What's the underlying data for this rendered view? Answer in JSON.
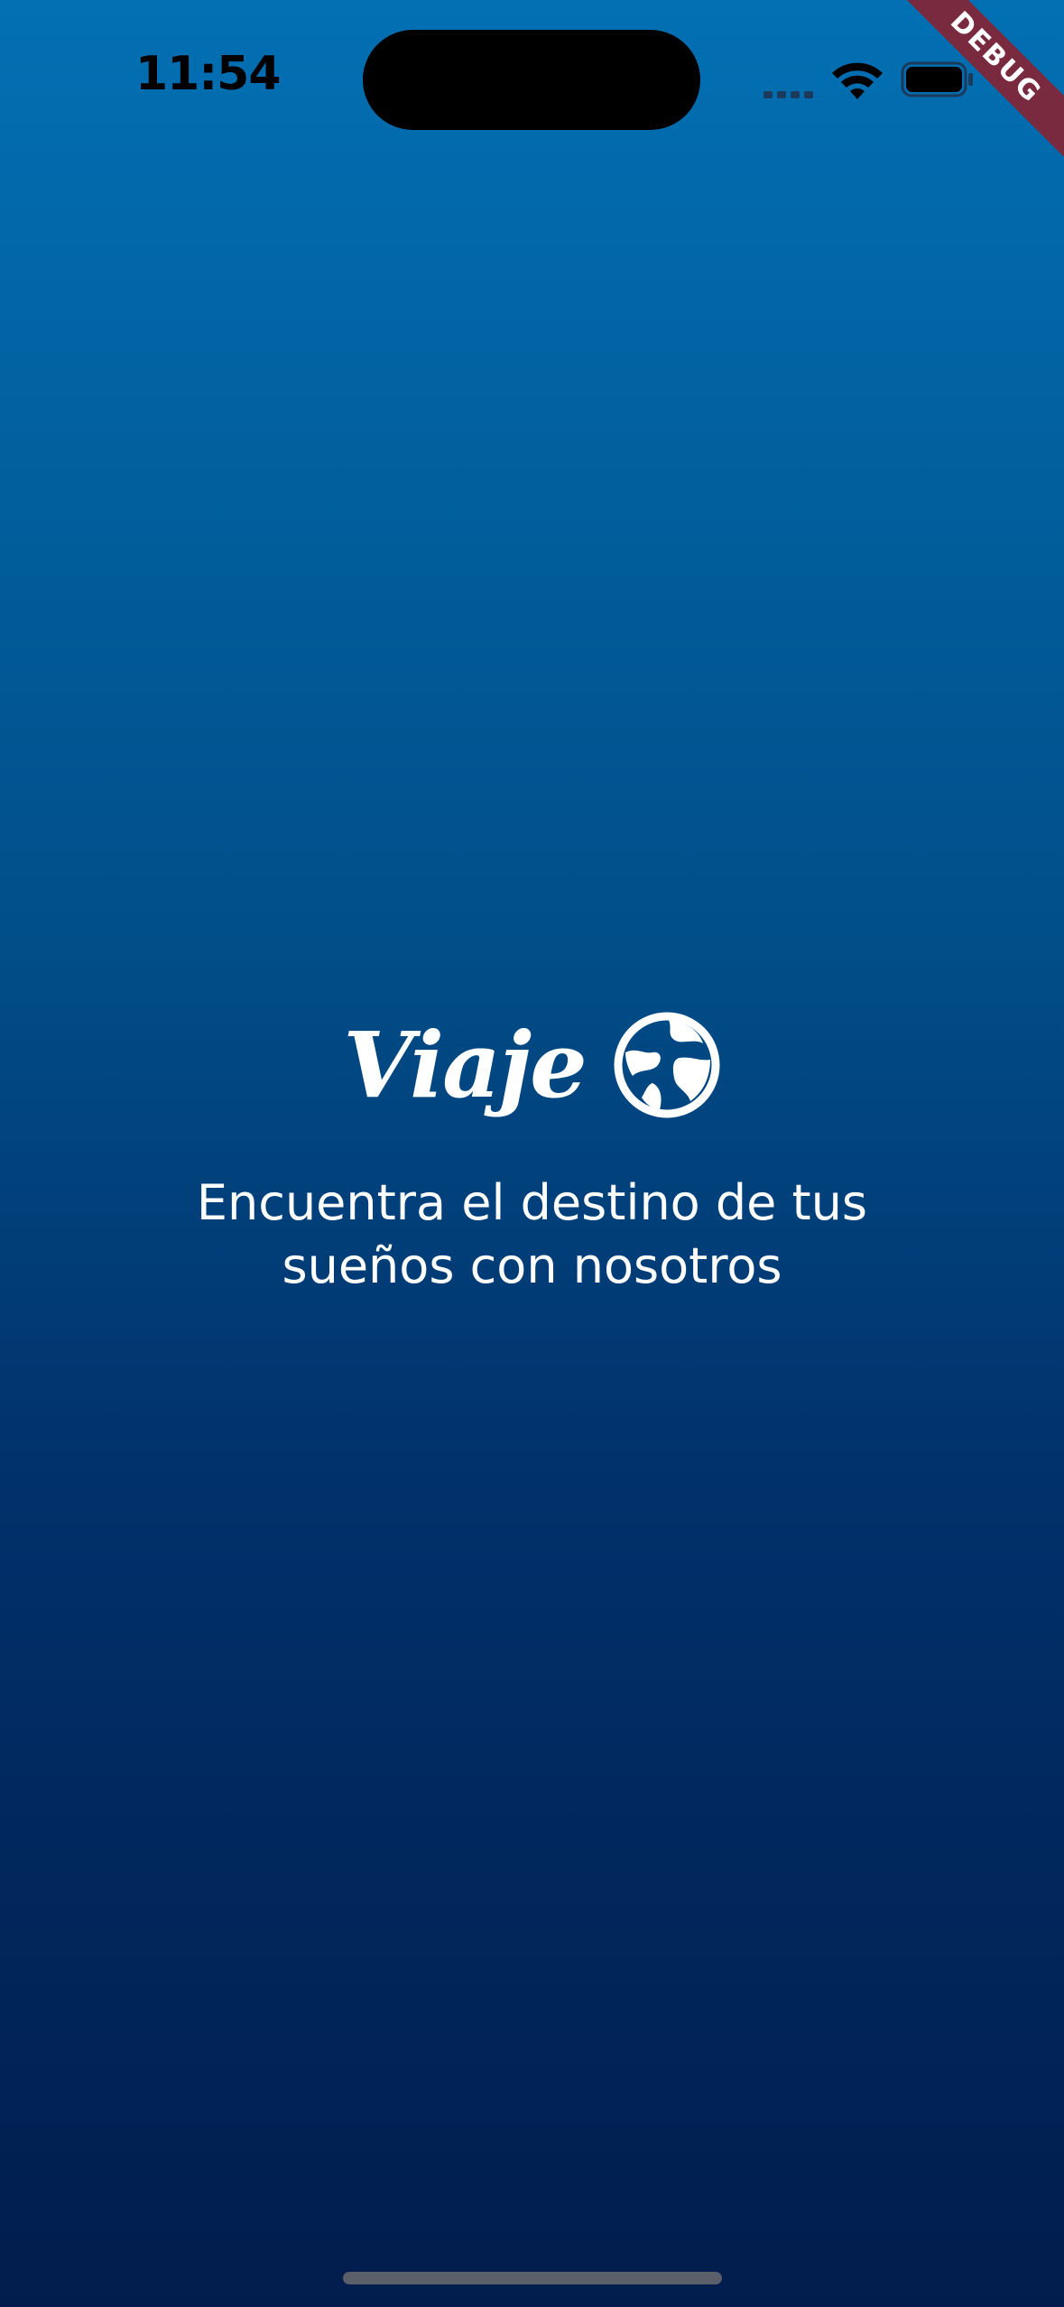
{
  "status_bar": {
    "time": "11:54",
    "debug_label": "DEBUG"
  },
  "splash": {
    "title": "Viaje",
    "logo_icon": "globe-icon",
    "tagline_line1": "Encuentra el destino de tus",
    "tagline_line2": "sueños con nosotros"
  },
  "colors": {
    "gradient_top": "#0270b3",
    "gradient_bottom": "#011d4d",
    "debug_ribbon": "#7a2a3e"
  }
}
